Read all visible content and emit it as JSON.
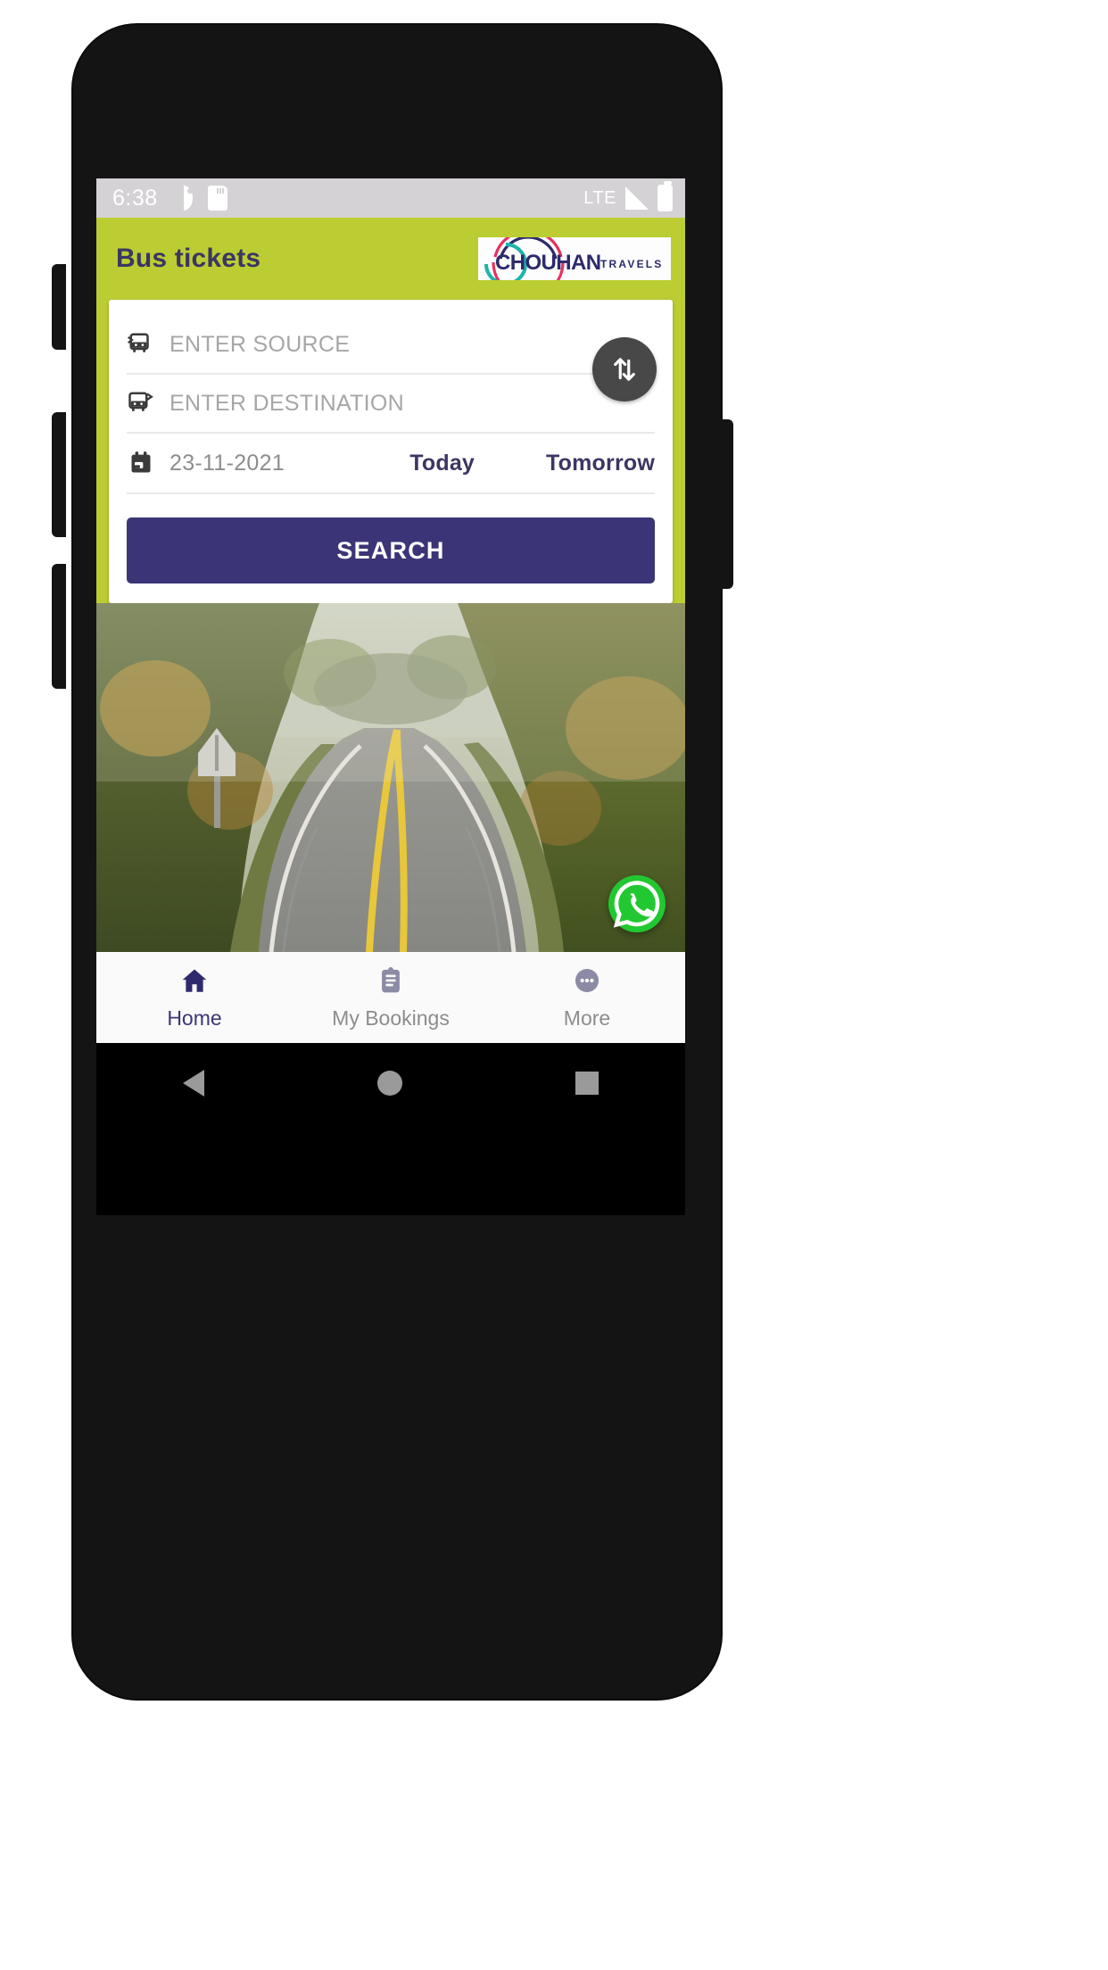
{
  "status_bar": {
    "time": "6:38",
    "network": "LTE",
    "icons_left": [
      "notification-oval-icon",
      "sd-card-icon"
    ],
    "icons_right": [
      "signal-bars-icon",
      "battery-icon"
    ]
  },
  "app_bar": {
    "title": "Bus tickets",
    "logo": {
      "brand": "CHOUHAN",
      "sub": "T R A V E L S",
      "colors": {
        "text": "#2b2a6b",
        "arc_pink": "#e8305f",
        "arc_teal": "#1fb3ac",
        "arc_navy": "#2b2a6b"
      }
    },
    "background": "#bccd33"
  },
  "search_card": {
    "source": {
      "placeholder": "ENTER SOURCE",
      "value": "",
      "icon": "bus-departure-icon"
    },
    "destination": {
      "placeholder": "ENTER DESTINATION",
      "value": "",
      "icon": "bus-arrival-icon"
    },
    "date": {
      "value": "23-11-2021",
      "icon": "calendar-icon"
    },
    "today_label": "Today",
    "tomorrow_label": "Tomorrow",
    "swap_icon": "swap-vertical-icon",
    "search_label": "SEARCH",
    "accent": "#3b3577"
  },
  "hero": {
    "alt": "highway-through-autumn-forest-photo"
  },
  "whatsapp_fab": {
    "icon": "whatsapp-icon",
    "color": "#22c831"
  },
  "bottom_nav": {
    "items": [
      {
        "label": "Home",
        "icon": "home-icon",
        "active": true
      },
      {
        "label": "My Bookings",
        "icon": "clipboard-icon",
        "active": false
      },
      {
        "label": "More",
        "icon": "ellipsis-circle-icon",
        "active": false
      }
    ],
    "active_color": "#3b3677",
    "inactive_color": "#8d8d8d"
  },
  "android_nav": {
    "back": "back-triangle-icon",
    "home": "home-circle-icon",
    "recents": "recents-square-icon"
  }
}
